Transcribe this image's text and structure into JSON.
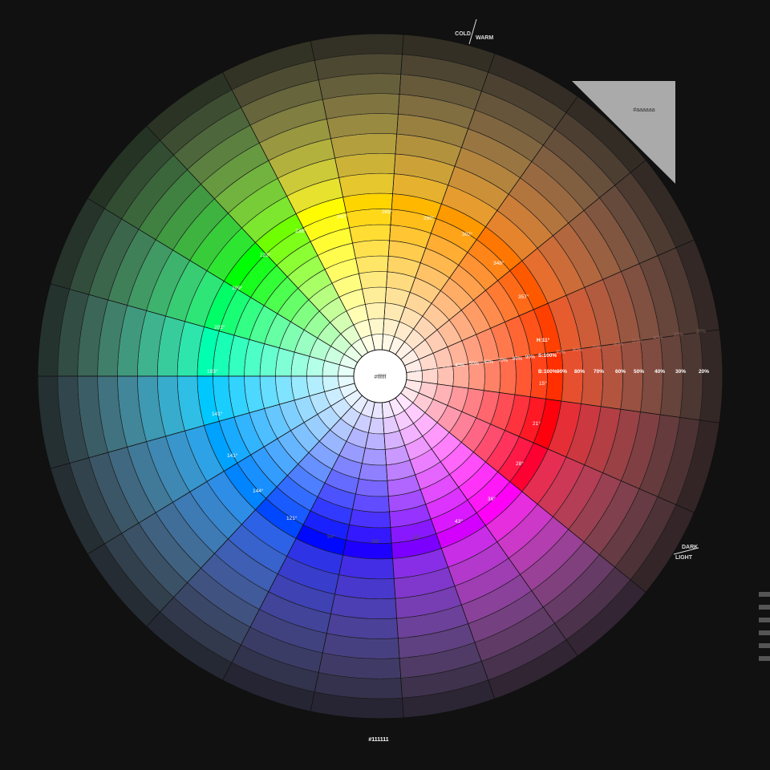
{
  "center_label": "#ffffff",
  "bottom_label": "#111111",
  "swatch_label": "#aaaaaa",
  "axis_labels": {
    "cold": "COLD",
    "warm": "WARM",
    "dark": "DARK",
    "light": "LIGHT"
  },
  "hue_row": {
    "h": "H:11°",
    "s": "S:100%",
    "b": "B:100%"
  },
  "saturation_labels": [
    "10%",
    "20%",
    "30%",
    "40%",
    "50%",
    "60%",
    "70%",
    "80%",
    "90%"
  ],
  "brightness_labels": [
    "90%",
    "80%",
    "70%",
    "60%",
    "50%",
    "40%",
    "30%",
    "20%"
  ],
  "hue_labels": [
    "15°",
    "21°",
    "28°",
    "36°",
    "43°",
    "50°",
    "59°",
    "94°",
    "121°",
    "144°",
    "141°",
    "193°",
    "202°",
    "209°",
    "223°",
    "238°",
    "247°",
    "269°",
    "290°",
    "302°",
    "348°",
    "357°"
  ],
  "colors": {
    "background": "#111111",
    "swatch": "#aaaaaa",
    "grid": "#111111",
    "text_light": "#ffffff"
  },
  "wheel": {
    "hue_sectors": [
      11,
      15,
      21,
      28,
      36,
      43,
      50,
      59,
      94,
      121,
      144,
      161,
      193,
      202,
      209,
      223,
      238,
      247,
      269,
      290,
      302,
      348,
      357
    ],
    "saturation_steps": [
      0,
      0.1,
      0.2,
      0.3,
      0.4,
      0.5,
      0.6,
      0.7,
      0.8,
      0.9,
      1.0
    ],
    "brightness_steps": [
      1.0,
      0.9,
      0.8,
      0.7,
      0.6,
      0.5,
      0.4,
      0.3,
      0.2
    ]
  }
}
